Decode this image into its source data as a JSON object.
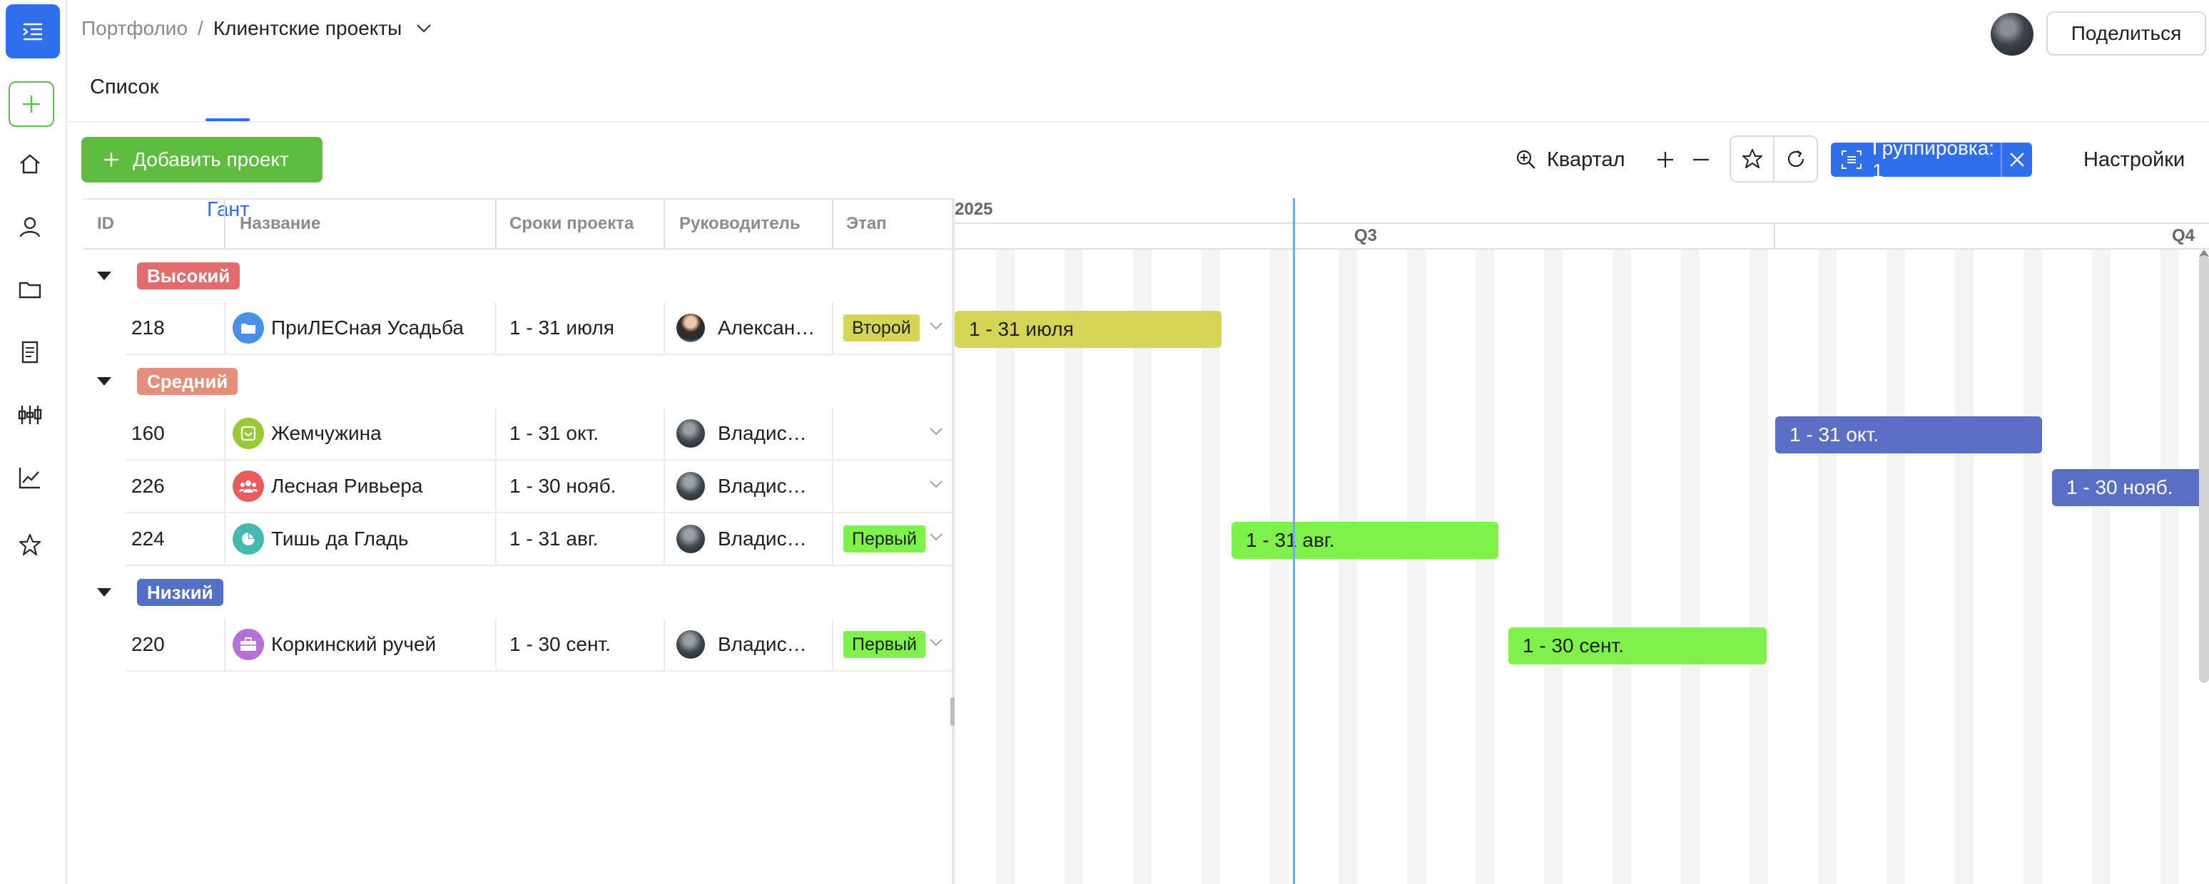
{
  "breadcrumb": {
    "root": "Портфолио",
    "separator": "/",
    "current": "Клиентские проекты"
  },
  "header": {
    "share_label": "Поделиться"
  },
  "tabs": [
    {
      "label": "Список"
    },
    {
      "label": "Гант"
    }
  ],
  "toolbar": {
    "add_project_label": "Добавить проект",
    "zoom_label": "Квартал",
    "plus_label": "+",
    "minus_label": "—",
    "grouping_label": "Группировка: 1",
    "settings_label": "Настройки"
  },
  "table": {
    "columns": {
      "id": "ID",
      "name": "Название",
      "dates": "Сроки проекта",
      "manager": "Руководитель",
      "stage": "Этап"
    },
    "groups": [
      {
        "label": "Высокий",
        "color": "#e26b6b"
      },
      {
        "label": "Средний",
        "color": "#e2907a"
      },
      {
        "label": "Низкий",
        "color": "#5470c6"
      }
    ],
    "rows": [
      {
        "id": "218",
        "name": "ПриЛЕСная Усадьба",
        "dates": "1 - 31 июля",
        "manager": "Александр",
        "stage": "Второй",
        "stage_color": "#d4d455",
        "icon": "folder-icon",
        "icon_color": "#4a8ee8"
      },
      {
        "id": "160",
        "name": "Жемчужина",
        "dates": "1 - 31 окт.",
        "manager": "Владислав",
        "stage": "",
        "stage_color": "",
        "icon": "inbox-icon",
        "icon_color": "#9bc73a"
      },
      {
        "id": "226",
        "name": "Лесная Ривьера",
        "dates": "1 - 30 нояб.",
        "manager": "Владислав",
        "stage": "",
        "stage_color": "",
        "icon": "team-icon",
        "icon_color": "#ea5c5c"
      },
      {
        "id": "224",
        "name": "Тишь да Гладь",
        "dates": "1 - 31 авг.",
        "manager": "Владислав",
        "stage": "Первый",
        "stage_color": "#7ef24a",
        "icon": "pie-chart-icon",
        "icon_color": "#45b8b0"
      },
      {
        "id": "220",
        "name": "Коркинский ручей",
        "dates": "1 - 30 сент.",
        "manager": "Владислав",
        "stage": "Первый",
        "stage_color": "#7ef24a",
        "icon": "briefcase-icon",
        "icon_color": "#b66fd6"
      }
    ]
  },
  "gantt": {
    "year": "2025",
    "quarters": [
      {
        "label": "Q3"
      },
      {
        "label": "Q4"
      }
    ],
    "bars": [
      {
        "label": "1 - 31 июля",
        "color": "#d4d455"
      },
      {
        "label": "1 - 31 окт.",
        "color": "#5a6fc4"
      },
      {
        "label": "1 - 30 нояб.",
        "color": "#5a6fc4"
      },
      {
        "label": "1 - 31 авг.",
        "color": "#7ef24a"
      },
      {
        "label": "1 - 30 сент.",
        "color": "#7ef24a"
      }
    ]
  },
  "colors": {
    "accent": "#2f6fed",
    "add_button": "#5cbd3f"
  }
}
